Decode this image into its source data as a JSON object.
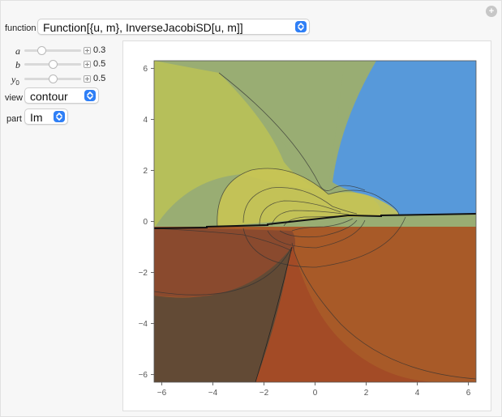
{
  "controls": {
    "function": {
      "label": "function",
      "value": "Function[{u, m}, InverseJacobiSD[u, m]]"
    },
    "sliders": [
      {
        "name": "a",
        "sub": "",
        "value": "0.3",
        "fraction": 0.3
      },
      {
        "name": "b",
        "sub": "",
        "value": "0.5",
        "fraction": 0.5
      },
      {
        "name": "y",
        "sub": "0",
        "value": "0.5",
        "fraction": 0.5
      }
    ],
    "view": {
      "label": "view",
      "value": "contour"
    },
    "part": {
      "label": "part",
      "value": "Im"
    }
  },
  "chart_data": {
    "type": "contour",
    "xlim": [
      -6.3,
      6.3
    ],
    "ylim": [
      -6.3,
      6.3
    ],
    "x_ticks": [
      -6,
      -4,
      -2,
      0,
      2,
      4,
      6
    ],
    "y_ticks": [
      -6,
      -4,
      -2,
      0,
      2,
      4,
      6
    ],
    "x_tick_labels": [
      "−6",
      "−4",
      "−2",
      "0",
      "2",
      "4",
      "6"
    ],
    "y_tick_labels": [
      "−6",
      "−4",
      "−2",
      "0",
      "2",
      "4",
      "6"
    ],
    "colors": {
      "top_left": "#b6bf5a",
      "top_middle": "#99ad73",
      "top_right": "#5799da",
      "bottom_left_upper": "#8a4a2e",
      "bottom_left_lower": "#624a35",
      "bottom_middle": "#a34b26",
      "bottom_right": "#a85a28"
    }
  }
}
